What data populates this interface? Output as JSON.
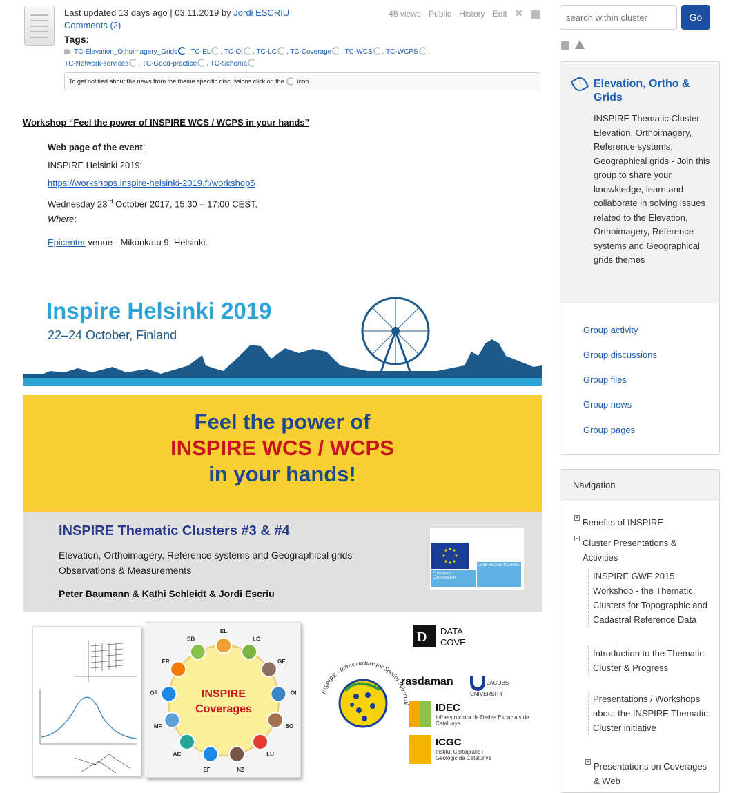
{
  "meta": {
    "updated_text": "Last updated 13 days ago | 03.11.2019 by",
    "author": "Jordi ESCRIU",
    "comments": "Comments (2)",
    "views": "48 views",
    "public": "Public",
    "history": "History",
    "edit": "Edit",
    "tags_title": "Tags:",
    "tags": [
      "TC-Elevation_Othoimagery_Grids",
      "TC-EL",
      "TC-OI",
      "TC-LC",
      "TC-Coverage",
      "TC-WCS",
      "TC-WCPS",
      "TC-Network-services",
      "TC-Good-practice",
      "TC-Schema"
    ],
    "notify_text_before": "To get notified about the news from the theme specific discussions click on the",
    "notify_text_after": "icon."
  },
  "content": {
    "workshop_title": "Workshop “Feel the power of INSPIRE WCS / WCPS in your hands”",
    "web_label": "Web page of the event",
    "web_colon": ":",
    "inspire_helsinki": "INSPIRE Helsinki 2019:",
    "url": "https://workshops.inspire-helsinki-2019.fi/workshop5",
    "date_prefix": "Wednesday 23",
    "date_sup": "rd",
    "date_suffix": " October 2017, 15:30 – 17:00 CEST.",
    "where_label": "Where",
    "where_colon": ":",
    "venue_link": "Epicenter",
    "venue_rest": " venue - Mikonkatu 9, Helsinki."
  },
  "banners": {
    "title": "Inspire Helsinki 2019",
    "subtitle": "22–24 October, Finland",
    "feel_line1": "Feel the power of",
    "feel_line2": "INSPIRE WCS / WCPS",
    "feel_line3": "in your hands!",
    "clusters_title": "INSPIRE Thematic Clusters #3 & #4",
    "clusters_line1": "Elevation, Orthoimagery, Reference systems and Geographical grids",
    "clusters_line2": "Observations & Measurements",
    "authors": "Peter Baumann & Kathi Schleidt & Jordi Escriu",
    "ec_left": "European Commission",
    "ec_right": "Joint Research Centre",
    "coverages_line1": "INSPIRE",
    "coverages_line2": "Coverages",
    "themes": [
      "EL",
      "LC",
      "GE",
      "OI",
      "SO",
      "LU",
      "NZ",
      "EF",
      "AC",
      "MF",
      "OF",
      "ER",
      "SD"
    ],
    "seal_text": "INSPIRE - Infrastructure for Spatial Information in Europe",
    "datacove_line1": "DATA",
    "datacove_line2": "COVE",
    "rasdaman": "rasdaman",
    "jacobs": "JACOBS UNIVERSITY",
    "idec_title": "IDEC",
    "idec_sub": "Infraestructura de Dades Espacials de Catalunya",
    "icgc_title": "ICGC",
    "icgc_sub": "Institut Cartogràfic i Geològic de Catalunya"
  },
  "sidebar": {
    "search_placeholder": "search within cluster",
    "go_label": "Go",
    "group_title": "Elevation, Ortho & Grids",
    "group_desc": "INSPIRE Thematic Cluster Elevation, Orthoimagery, Reference systems, Geographical grids - Join this group to share your knowkledge, learn and collaborate in solving issues related to the Elevation, Orthoimagery, Reference systems and Geographical grids themes",
    "group_links": [
      "Group activity",
      "Group discussions",
      "Group files",
      "Group news",
      "Group pages"
    ],
    "nav_title": "Navigation",
    "nav_items": [
      "Benefits of INSPIRE",
      "Cluster Presentations & Activities",
      "INSPIRE GWF 2015 Workshop - the Thematic Clusters for Topographic and Cadastral Reference Data",
      "Introduction to the Thematic Cluster & Progress",
      "Presentations / Workshops about the INSPIRE Thematic Cluster initiative",
      "Presentations on Coverages & Web"
    ]
  }
}
